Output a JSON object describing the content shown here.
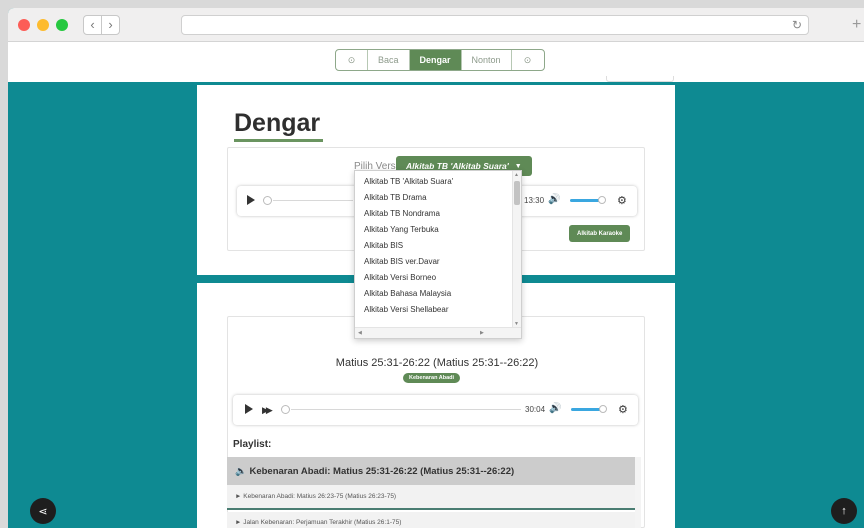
{
  "browser": {
    "back_icon": "chevron-left-icon",
    "forward_icon": "chevron-right-icon",
    "reload_icon": "reload-icon",
    "new_tab_icon": "plus-icon"
  },
  "topnav": {
    "items": [
      {
        "label": "Baca"
      },
      {
        "label": "Dengar"
      },
      {
        "label": "Nonton"
      }
    ],
    "active": "Dengar"
  },
  "audio_section": {
    "title": "Dengar",
    "version_label": "Pilih Versi",
    "selected_version": "Alkitab TB 'Alkitab Suara'",
    "player": {
      "duration": "13:30"
    },
    "karaoke_button": "Alkitab Karaoke"
  },
  "dropdown": {
    "options": [
      "Alkitab TB 'Alkitab Suara'",
      "Alkitab TB Drama",
      "Alkitab TB Nondrama",
      "Alkitab Yang Terbuka",
      "Alkitab BIS",
      "Alkitab BIS ver.Davar",
      "Alkitab Versi Borneo",
      "Alkitab Bahasa Malaysia",
      "Alkitab Versi Shellabear"
    ]
  },
  "podcast_section": {
    "passage": "Matius 25:31-26:22 (Matius 25:31--26:22)",
    "badge": "Kebenaran Abadi",
    "player": {
      "duration": "30:04"
    },
    "playlist_label": "Playlist:",
    "playlist": [
      "Kebenaran Abadi: Matius 25:31-26:22 (Matius 25:31--26:22)",
      "Kebenaran Abadi: Matius 26:23-75 (Matius 26:23-75)",
      "Jalan Kebenaran: Perjamuan Terakhir (Matius 26:1-75)"
    ]
  },
  "colors": {
    "background": "#0e8a92",
    "accent": "#5f8a56",
    "volume": "#3aa7e0"
  }
}
